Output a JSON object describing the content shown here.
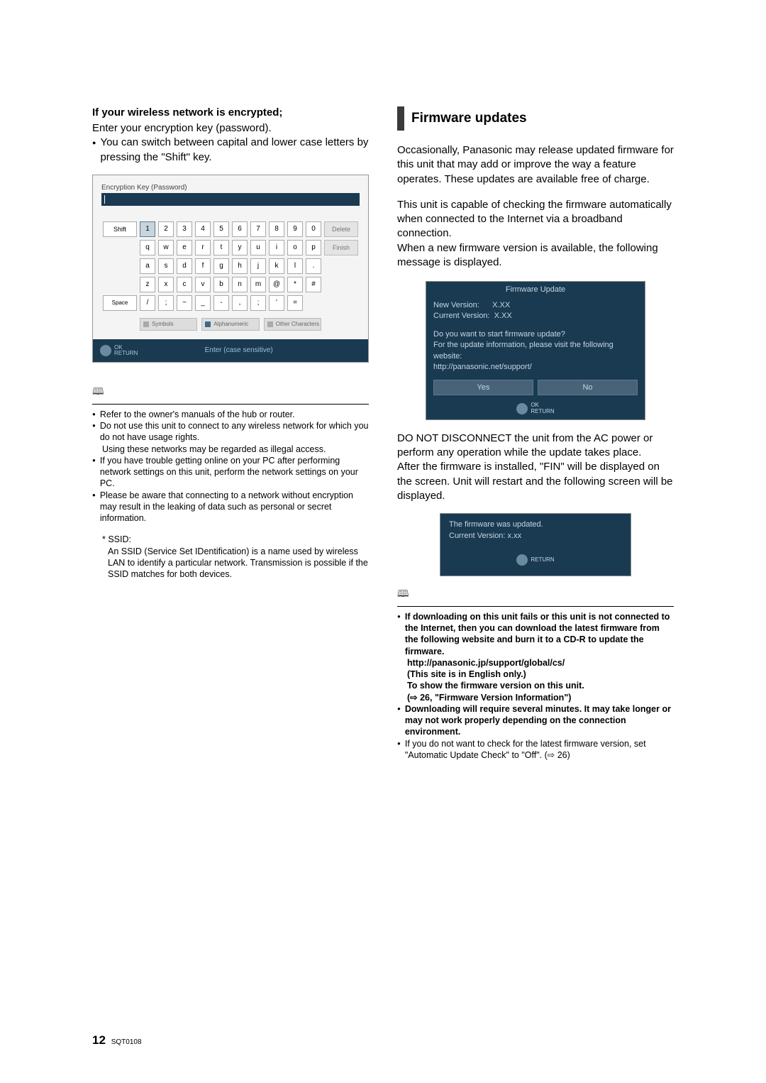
{
  "left": {
    "heading": "If your wireless network is encrypted;",
    "para1": "Enter your encryption key (password).",
    "bullet1": "You can switch between capital and lower case letters by pressing the \"Shift\" key.",
    "keyboard": {
      "title": "Encryption Key (Password)",
      "shift": "Shift",
      "row1": [
        "1",
        "2",
        "3",
        "4",
        "5",
        "6",
        "7",
        "8",
        "9",
        "0"
      ],
      "delete": "Delete",
      "row2": [
        "q",
        "w",
        "e",
        "r",
        "t",
        "y",
        "u",
        "i",
        "o",
        "p"
      ],
      "finish": "Finish",
      "row3": [
        "a",
        "s",
        "d",
        "f",
        "g",
        "h",
        "j",
        "k",
        "l",
        "."
      ],
      "row4": [
        "z",
        "x",
        "c",
        "v",
        "b",
        "n",
        "m",
        "@",
        "*",
        "#"
      ],
      "space": "Space",
      "row5": [
        "/",
        ";",
        "~",
        "_",
        "-",
        ",",
        ";",
        "'",
        "="
      ],
      "mode1": "Symbols",
      "mode2": "Alphanumeric",
      "mode3": "Other Characters",
      "footer_ok": "OK",
      "footer_return": "RETURN",
      "footer_center": "Enter (case sensitive)"
    },
    "notes": {
      "n1": "Refer to the owner's manuals of the hub or router.",
      "n2": "Do not use this unit to connect to any wireless network for which you do not have usage rights.",
      "n2b": "Using these networks may be regarded as illegal access.",
      "n3": "If you have trouble getting online on your PC after performing network settings on this unit, perform the network settings on your PC.",
      "n4": "Please be aware that connecting to a network without encryption may result in the leaking of data such as personal or secret information.",
      "ssid_label": "* SSID:",
      "ssid_text": "An SSID (Service Set IDentification) is a name used by wireless LAN to identify a particular network. Transmission is possible if the SSID matches for both devices."
    }
  },
  "right": {
    "heading": "Firmware updates",
    "para1": "Occasionally, Panasonic may release updated firmware for this unit that may add or improve the way a feature operates. These updates are available free of charge.",
    "para2": "This unit is capable of checking the firmware automatically when connected to the Internet via a broadband connection.",
    "para3": "When a new firmware version is available, the following message is displayed.",
    "dialog1": {
      "title": "Firmware Update",
      "line1a": "New Version:",
      "line1b": "X.XX",
      "line2a": "Current Version:",
      "line2b": "X.XX",
      "q1": "Do you want to start firmware update?",
      "q2": "For the update information, please visit the following website:",
      "q3": "http://panasonic.net/support/",
      "yes": "Yes",
      "no": "No",
      "ok": "OK",
      "return": "RETURN"
    },
    "para4": "DO NOT DISCONNECT the unit from the AC power or perform any operation while the update takes place.",
    "para5": "After the firmware is installed, \"FIN\" will be displayed on the screen. Unit will restart and the following screen will be displayed.",
    "dialog2": {
      "line1": "The firmware was updated.",
      "line2a": "Current Version:",
      "line2b": "x.xx",
      "return": "RETURN"
    },
    "notes": {
      "b1": "If downloading on this unit fails or this unit is not connected to the Internet, then you can download the latest firmware from the following website and burn it to a CD-R to update the firmware.",
      "b1b": "http://panasonic.jp/support/global/cs/",
      "b1c": "(This site is in English only.)",
      "b1d": "To show the firmware version on this unit.",
      "b1e": "(⇨ 26, \"Firmware Version Information\")",
      "b2": "Downloading will require several minutes. It may take longer or may not work properly depending on the connection environment.",
      "b3": "If you do not want to check for the latest firmware version, set \"Automatic Update Check\" to \"Off\". (⇨ 26)"
    }
  },
  "page": {
    "num": "12",
    "code": "SQT0108"
  }
}
